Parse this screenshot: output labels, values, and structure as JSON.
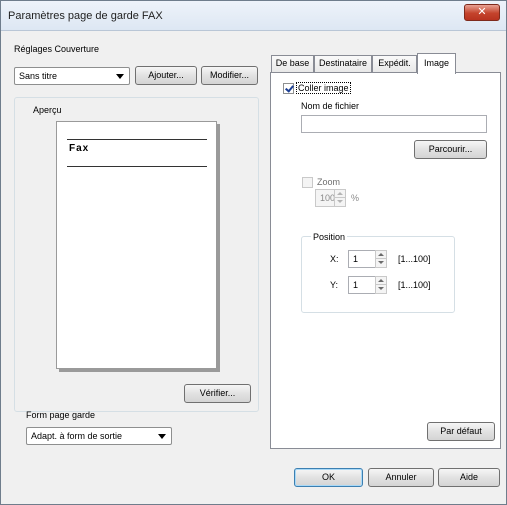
{
  "window": {
    "title": "Paramètres page de garde FAX",
    "close_glyph": "✕"
  },
  "cover": {
    "group_label": "Réglages Couverture",
    "selected": "Sans titre",
    "add_label": "Ajouter...",
    "modify_label": "Modifier..."
  },
  "preview": {
    "group_label": "Aperçu",
    "fax_text": "Fax",
    "verify_label": "Vérifier..."
  },
  "form": {
    "label": "Form page garde",
    "selected": "Adapt. à form de sortie"
  },
  "tabs": [
    {
      "label": "De base",
      "active": false
    },
    {
      "label": "Destinataire",
      "active": false
    },
    {
      "label": "Expédit.",
      "active": false
    },
    {
      "label": "Image",
      "active": true
    }
  ],
  "image_tab": {
    "paste_image_label": "Coller image",
    "paste_image_checked": true,
    "filename_label": "Nom de fichier",
    "filename_value": "",
    "browse_label": "Parcourir...",
    "zoom_label": "Zoom",
    "zoom_checked": false,
    "zoom_value": "100",
    "zoom_unit": "%",
    "position_label": "Position",
    "x_label": "X:",
    "x_value": "1",
    "x_range": "[1...100]",
    "y_label": "Y:",
    "y_value": "1",
    "y_range": "[1...100]",
    "default_label": "Par défaut"
  },
  "footer": {
    "ok_label": "OK",
    "cancel_label": "Annuler",
    "help_label": "Aide"
  },
  "colors": {
    "close_button": "#c4432c",
    "default_button_border": "#3c7fb1",
    "check_mark": "#1c3f94"
  }
}
